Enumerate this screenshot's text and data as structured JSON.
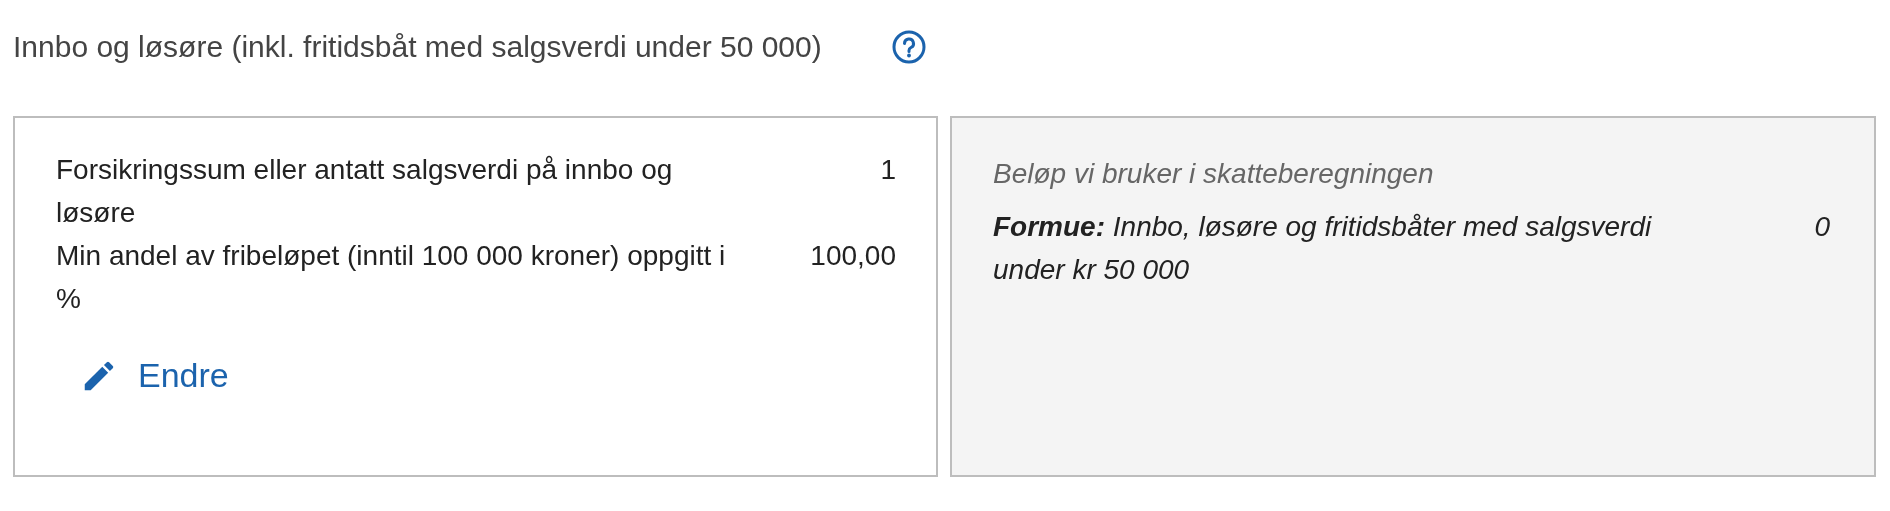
{
  "title": "Innbo og løsøre (inkl. fritidsbåt med salgsverdi under 50 000)",
  "input_card": {
    "rows": [
      {
        "label": "Forsikringssum eller antatt salgsverdi på innbo og løsøre",
        "value": "1"
      },
      {
        "label": "Min andel av fribeløpet (inntil 100 000 kroner) oppgitt i %",
        "value": "100,00"
      }
    ],
    "edit_button": "Endre"
  },
  "result_card": {
    "heading": "Beløp vi bruker i skatteberegningen",
    "rows": [
      {
        "label": "**Formue:** Innbo, løsøre og fritidsbåter med salgsverdi under kr 50 000",
        "value": "0"
      }
    ]
  }
}
